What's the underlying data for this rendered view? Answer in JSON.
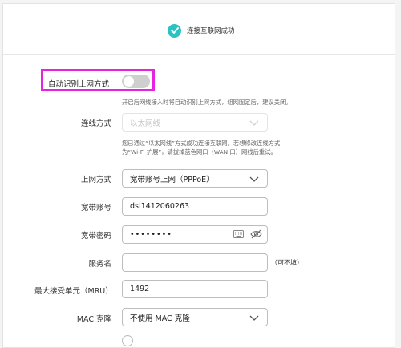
{
  "status": {
    "text": "连接互联网成功"
  },
  "auto_detect": {
    "label": "自动识别上网方式",
    "enabled": false,
    "hint": "开启后网线接入时将自动识别上网方式，组网固定后，建议关闭。"
  },
  "connection_type": {
    "label": "连线方式",
    "value": "以太网线",
    "note_line1": "您已通过“以太网线”方式成功连接互联网。若想修改连线方式",
    "note_line2": "为“Wi-Fi 扩展”，请拔掉蓝色网口（WAN 口）网线后重试。"
  },
  "internet_mode": {
    "label": "上网方式",
    "value": "宽带账号上网（PPPoE）"
  },
  "account": {
    "label": "宽带账号",
    "value": "dsl1412060263"
  },
  "password": {
    "label": "宽带密码",
    "value": "••••••••"
  },
  "service_name": {
    "label": "服务名",
    "value": "",
    "suffix": "（可不填）"
  },
  "mru": {
    "label": "最大接受单元（MRU）",
    "value": "1492"
  },
  "mac_clone": {
    "label": "MAC 克隆",
    "value": "不使用 MAC 克隆"
  },
  "colors": {
    "accent": "#2cc2c2",
    "highlight": "#e623e0",
    "toggle_off": "#cfcfcf"
  }
}
